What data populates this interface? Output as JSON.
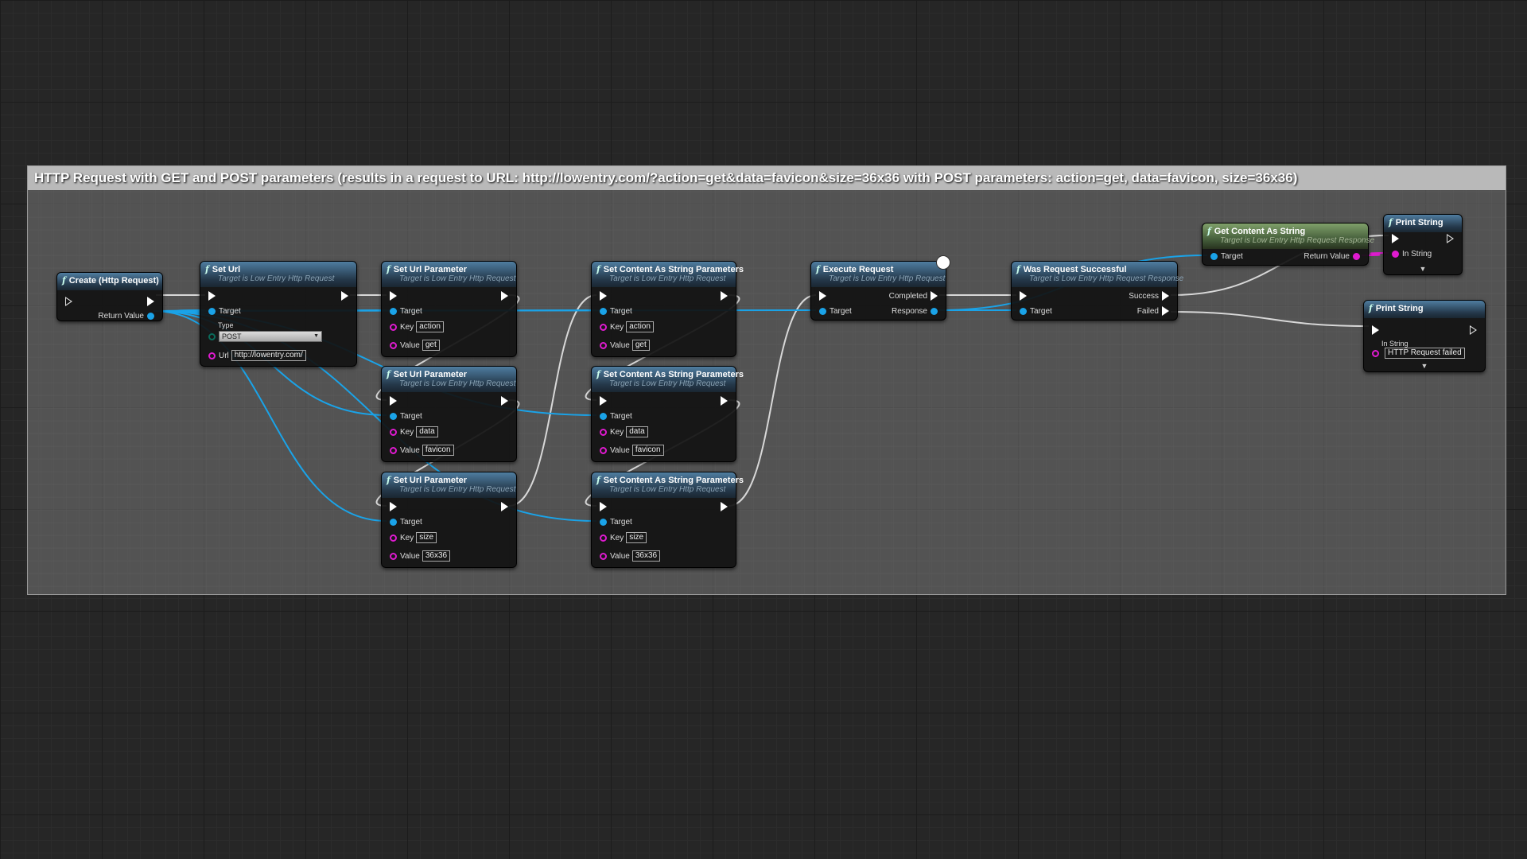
{
  "comment": {
    "title": "HTTP Request with GET and POST parameters (results in a request to URL: http://lowentry.com/?action=get&data=favicon&size=36x36 with POST parameters: action=get, data=favicon, size=36x36)"
  },
  "colors": {
    "exec": "#ffffff",
    "object_pin": "#1aa3e8",
    "string_pin": "#e01ad0",
    "header_blue": "#4f7da0",
    "header_green": "#7fa06a"
  },
  "nodes": {
    "create": {
      "title": "Create (Http Request)",
      "return_label": "Return Value"
    },
    "seturl": {
      "title": "Set Url",
      "subtitle": "Target is Low Entry Http Request",
      "target": "Target",
      "type_label": "Type",
      "type_value": "POST",
      "url_label": "Url",
      "url_value": "http://lowentry.com/"
    },
    "sup1": {
      "title": "Set Url Parameter",
      "subtitle": "Target is Low Entry Http Request",
      "target": "Target",
      "key_label": "Key",
      "key": "action",
      "value_label": "Value",
      "value": "get"
    },
    "sup2": {
      "title": "Set Url Parameter",
      "subtitle": "Target is Low Entry Http Request",
      "target": "Target",
      "key_label": "Key",
      "key": "data",
      "value_label": "Value",
      "value": "favicon"
    },
    "sup3": {
      "title": "Set Url Parameter",
      "subtitle": "Target is Low Entry Http Request",
      "target": "Target",
      "key_label": "Key",
      "key": "size",
      "value_label": "Value",
      "value": "36x36"
    },
    "scp1": {
      "title": "Set Content As String Parameters",
      "subtitle": "Target is Low Entry Http Request",
      "target": "Target",
      "key_label": "Key",
      "key": "action",
      "value_label": "Value",
      "value": "get"
    },
    "scp2": {
      "title": "Set Content As String Parameters",
      "subtitle": "Target is Low Entry Http Request",
      "target": "Target",
      "key_label": "Key",
      "key": "data",
      "value_label": "Value",
      "value": "favicon"
    },
    "scp3": {
      "title": "Set Content As String Parameters",
      "subtitle": "Target is Low Entry Http Request",
      "target": "Target",
      "key_label": "Key",
      "key": "size",
      "value_label": "Value",
      "value": "36x36"
    },
    "exec": {
      "title": "Execute Request",
      "subtitle": "Target is Low Entry Http Request",
      "completed": "Completed",
      "target": "Target",
      "response": "Response"
    },
    "was": {
      "title": "Was Request Successful",
      "subtitle": "Target is Low Entry Http Request Response",
      "success": "Success",
      "target": "Target",
      "failed": "Failed"
    },
    "getc": {
      "title": "Get Content As String",
      "subtitle": "Target is Low Entry Http Request Response",
      "target": "Target",
      "return_label": "Return Value"
    },
    "print1": {
      "title": "Print String",
      "in_label": "In String"
    },
    "print2": {
      "title": "Print String",
      "in_label": "In String",
      "in_value": "HTTP Request failed"
    }
  }
}
